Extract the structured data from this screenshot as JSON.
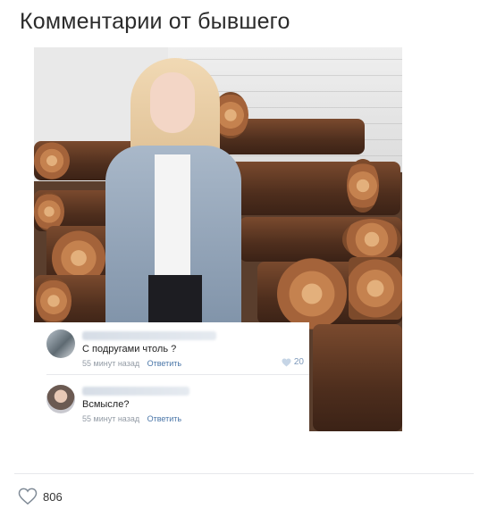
{
  "post": {
    "title": "Комментарии от бывшего"
  },
  "comments": [
    {
      "text": "С подругами чтоль ?",
      "time": "55 минут назад",
      "reply_label": "Ответить",
      "likes": "20"
    },
    {
      "text": "Всмысле?",
      "time": "55 минут назад",
      "reply_label": "Ответить"
    }
  ],
  "footer": {
    "likes_count": "806",
    "like_icon": "heart-icon"
  },
  "colors": {
    "link": "#4a76a8",
    "meta": "#939ba5",
    "like_small": "#7e99bb"
  }
}
